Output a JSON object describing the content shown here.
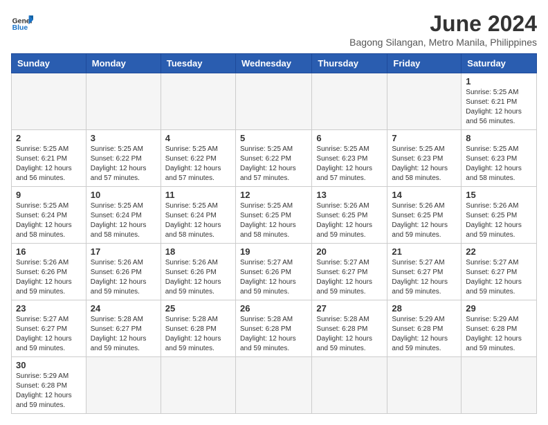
{
  "header": {
    "logo_general": "General",
    "logo_blue": "Blue",
    "month_year": "June 2024",
    "location": "Bagong Silangan, Metro Manila, Philippines"
  },
  "weekdays": [
    "Sunday",
    "Monday",
    "Tuesday",
    "Wednesday",
    "Thursday",
    "Friday",
    "Saturday"
  ],
  "weeks": [
    [
      {
        "day": "",
        "info": ""
      },
      {
        "day": "",
        "info": ""
      },
      {
        "day": "",
        "info": ""
      },
      {
        "day": "",
        "info": ""
      },
      {
        "day": "",
        "info": ""
      },
      {
        "day": "",
        "info": ""
      },
      {
        "day": "1",
        "info": "Sunrise: 5:25 AM\nSunset: 6:21 PM\nDaylight: 12 hours and 56 minutes."
      }
    ],
    [
      {
        "day": "2",
        "info": "Sunrise: 5:25 AM\nSunset: 6:21 PM\nDaylight: 12 hours and 56 minutes."
      },
      {
        "day": "3",
        "info": "Sunrise: 5:25 AM\nSunset: 6:22 PM\nDaylight: 12 hours and 57 minutes."
      },
      {
        "day": "4",
        "info": "Sunrise: 5:25 AM\nSunset: 6:22 PM\nDaylight: 12 hours and 57 minutes."
      },
      {
        "day": "5",
        "info": "Sunrise: 5:25 AM\nSunset: 6:22 PM\nDaylight: 12 hours and 57 minutes."
      },
      {
        "day": "6",
        "info": "Sunrise: 5:25 AM\nSunset: 6:23 PM\nDaylight: 12 hours and 57 minutes."
      },
      {
        "day": "7",
        "info": "Sunrise: 5:25 AM\nSunset: 6:23 PM\nDaylight: 12 hours and 58 minutes."
      },
      {
        "day": "8",
        "info": "Sunrise: 5:25 AM\nSunset: 6:23 PM\nDaylight: 12 hours and 58 minutes."
      }
    ],
    [
      {
        "day": "9",
        "info": "Sunrise: 5:25 AM\nSunset: 6:24 PM\nDaylight: 12 hours and 58 minutes."
      },
      {
        "day": "10",
        "info": "Sunrise: 5:25 AM\nSunset: 6:24 PM\nDaylight: 12 hours and 58 minutes."
      },
      {
        "day": "11",
        "info": "Sunrise: 5:25 AM\nSunset: 6:24 PM\nDaylight: 12 hours and 58 minutes."
      },
      {
        "day": "12",
        "info": "Sunrise: 5:25 AM\nSunset: 6:25 PM\nDaylight: 12 hours and 58 minutes."
      },
      {
        "day": "13",
        "info": "Sunrise: 5:26 AM\nSunset: 6:25 PM\nDaylight: 12 hours and 59 minutes."
      },
      {
        "day": "14",
        "info": "Sunrise: 5:26 AM\nSunset: 6:25 PM\nDaylight: 12 hours and 59 minutes."
      },
      {
        "day": "15",
        "info": "Sunrise: 5:26 AM\nSunset: 6:25 PM\nDaylight: 12 hours and 59 minutes."
      }
    ],
    [
      {
        "day": "16",
        "info": "Sunrise: 5:26 AM\nSunset: 6:26 PM\nDaylight: 12 hours and 59 minutes."
      },
      {
        "day": "17",
        "info": "Sunrise: 5:26 AM\nSunset: 6:26 PM\nDaylight: 12 hours and 59 minutes."
      },
      {
        "day": "18",
        "info": "Sunrise: 5:26 AM\nSunset: 6:26 PM\nDaylight: 12 hours and 59 minutes."
      },
      {
        "day": "19",
        "info": "Sunrise: 5:27 AM\nSunset: 6:26 PM\nDaylight: 12 hours and 59 minutes."
      },
      {
        "day": "20",
        "info": "Sunrise: 5:27 AM\nSunset: 6:27 PM\nDaylight: 12 hours and 59 minutes."
      },
      {
        "day": "21",
        "info": "Sunrise: 5:27 AM\nSunset: 6:27 PM\nDaylight: 12 hours and 59 minutes."
      },
      {
        "day": "22",
        "info": "Sunrise: 5:27 AM\nSunset: 6:27 PM\nDaylight: 12 hours and 59 minutes."
      }
    ],
    [
      {
        "day": "23",
        "info": "Sunrise: 5:27 AM\nSunset: 6:27 PM\nDaylight: 12 hours and 59 minutes."
      },
      {
        "day": "24",
        "info": "Sunrise: 5:28 AM\nSunset: 6:27 PM\nDaylight: 12 hours and 59 minutes."
      },
      {
        "day": "25",
        "info": "Sunrise: 5:28 AM\nSunset: 6:28 PM\nDaylight: 12 hours and 59 minutes."
      },
      {
        "day": "26",
        "info": "Sunrise: 5:28 AM\nSunset: 6:28 PM\nDaylight: 12 hours and 59 minutes."
      },
      {
        "day": "27",
        "info": "Sunrise: 5:28 AM\nSunset: 6:28 PM\nDaylight: 12 hours and 59 minutes."
      },
      {
        "day": "28",
        "info": "Sunrise: 5:29 AM\nSunset: 6:28 PM\nDaylight: 12 hours and 59 minutes."
      },
      {
        "day": "29",
        "info": "Sunrise: 5:29 AM\nSunset: 6:28 PM\nDaylight: 12 hours and 59 minutes."
      }
    ],
    [
      {
        "day": "30",
        "info": "Sunrise: 5:29 AM\nSunset: 6:28 PM\nDaylight: 12 hours and 59 minutes."
      },
      {
        "day": "",
        "info": ""
      },
      {
        "day": "",
        "info": ""
      },
      {
        "day": "",
        "info": ""
      },
      {
        "day": "",
        "info": ""
      },
      {
        "day": "",
        "info": ""
      },
      {
        "day": "",
        "info": ""
      }
    ]
  ]
}
